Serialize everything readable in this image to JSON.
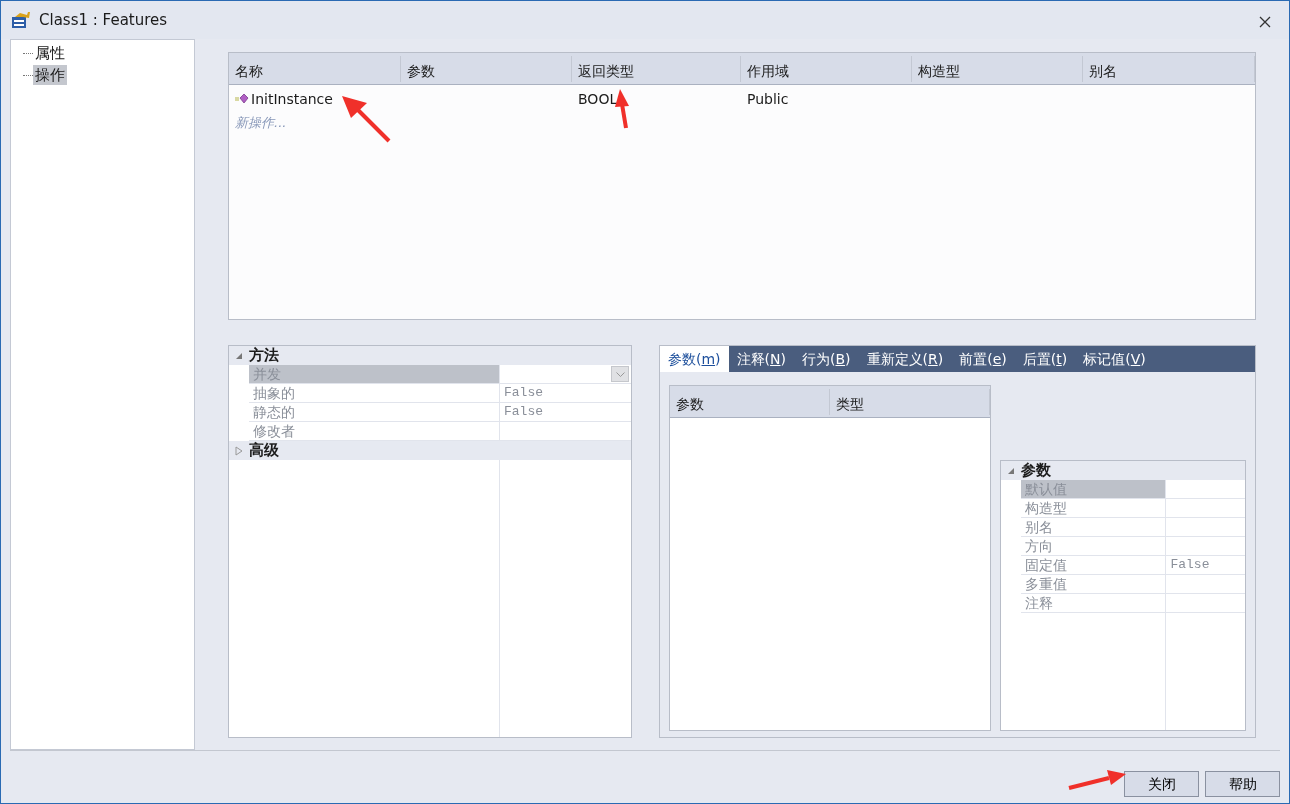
{
  "window": {
    "title": "Class1 : Features"
  },
  "tree": {
    "items": [
      {
        "label": "属性",
        "selected": false
      },
      {
        "label": "操作",
        "selected": true
      }
    ]
  },
  "operations_table": {
    "columns": [
      "名称",
      "参数",
      "返回类型",
      "作用域",
      "构造型",
      "别名"
    ],
    "rows": [
      {
        "cells": [
          "InitInstance",
          "",
          "BOOL",
          "Public",
          "",
          ""
        ]
      }
    ],
    "new_row_hint": "新操作..."
  },
  "method_properties": {
    "groups": [
      {
        "label": "方法",
        "expanded": true,
        "rows": [
          {
            "label": "并发",
            "selected": true,
            "kind": "dropdown"
          },
          {
            "label": "抽象的",
            "value": "False",
            "selected": false
          },
          {
            "label": "静态的",
            "value": "False",
            "selected": false
          },
          {
            "label": "修改者",
            "selected": false
          }
        ]
      },
      {
        "label": "高级",
        "expanded": false
      }
    ]
  },
  "tabs": [
    {
      "before": "参数(",
      "key": "m",
      "after": ")",
      "selected": true
    },
    {
      "before": "注释(",
      "key": "N",
      "after": ")",
      "selected": false
    },
    {
      "before": "行为(",
      "key": "B",
      "after": ")",
      "selected": false
    },
    {
      "before": "重新定义(",
      "key": "R",
      "after": ")",
      "selected": false
    },
    {
      "before": "前置(",
      "key": "e",
      "after": ")",
      "selected": false
    },
    {
      "before": "后置(",
      "key": "t",
      "after": ")",
      "selected": false
    },
    {
      "before": "标记值(",
      "key": "V",
      "after": ")",
      "selected": false
    }
  ],
  "params_table": {
    "columns": [
      "参数",
      "类型"
    ]
  },
  "param_properties": {
    "groups": [
      {
        "label": "参数",
        "expanded": true,
        "rows": [
          {
            "label": "默认值",
            "selected": true
          },
          {
            "label": "构造型",
            "selected": false
          },
          {
            "label": "别名",
            "selected": false
          },
          {
            "label": "方向",
            "selected": false
          },
          {
            "label": "固定值",
            "value": "False",
            "selected": false
          },
          {
            "label": "多重值",
            "selected": false
          },
          {
            "label": "注释",
            "selected": false
          }
        ]
      }
    ]
  },
  "buttons": [
    "关闭",
    "帮助"
  ]
}
